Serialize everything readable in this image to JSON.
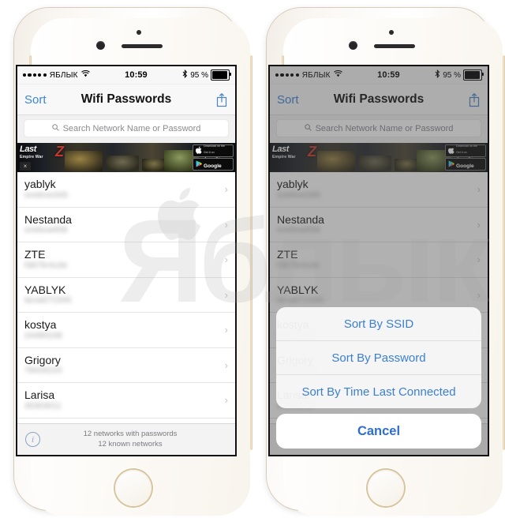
{
  "status_bar": {
    "signal_dots": 5,
    "carrier": "ЯБЛЫК",
    "wifi_icon": "wifi-icon",
    "time": "10:59",
    "bluetooth_icon": "bluetooth-icon",
    "battery_percent": "95 %",
    "battery_level": 95
  },
  "nav_bar": {
    "sort_label": "Sort",
    "title": "Wifi Passwords",
    "share_icon": "share-icon"
  },
  "search": {
    "placeholder": "Search Network Name or Password",
    "value": "",
    "icon": "search-icon"
  },
  "ad": {
    "title": "Last",
    "subtitle": "Empire War",
    "mark": "Z",
    "close_label": "×",
    "appstore": {
      "top": "Download on the",
      "bottom": "App Store",
      "icon": "apple-icon"
    },
    "gplay": {
      "top": "Get it on",
      "bottom": "Google play",
      "icon": "google-play-icon"
    }
  },
  "networks": [
    {
      "ssid": "yablyk",
      "password": "onekive345"
    },
    {
      "ssid": "Nestanda",
      "password": "onebxw658"
    },
    {
      "ssid": "ZTE",
      "password": "f3875r4u3e"
    },
    {
      "ssid": "YABLYK",
      "password": "larsa072345"
    },
    {
      "ssid": "kostya",
      "password": "24480248"
    },
    {
      "ssid": "Grigory",
      "password": "78426220"
    },
    {
      "ssid": "Larisa",
      "password": "45303011"
    }
  ],
  "footer": {
    "info_icon": "info-icon",
    "line1": "12 networks with passwords",
    "line2": "12 known networks"
  },
  "action_sheet": {
    "options": [
      "Sort By SSID",
      "Sort By Password",
      "Sort By Time Last Connected"
    ],
    "cancel_label": "Cancel"
  },
  "watermark": {
    "text": "Яблык",
    "apple_icon": "apple-logo-icon"
  },
  "colors": {
    "accent_blue": "#3b86d6",
    "cancel_blue": "#2d6fd0",
    "muted_text": "#7c7c80",
    "separator": "#e4e4e6"
  }
}
